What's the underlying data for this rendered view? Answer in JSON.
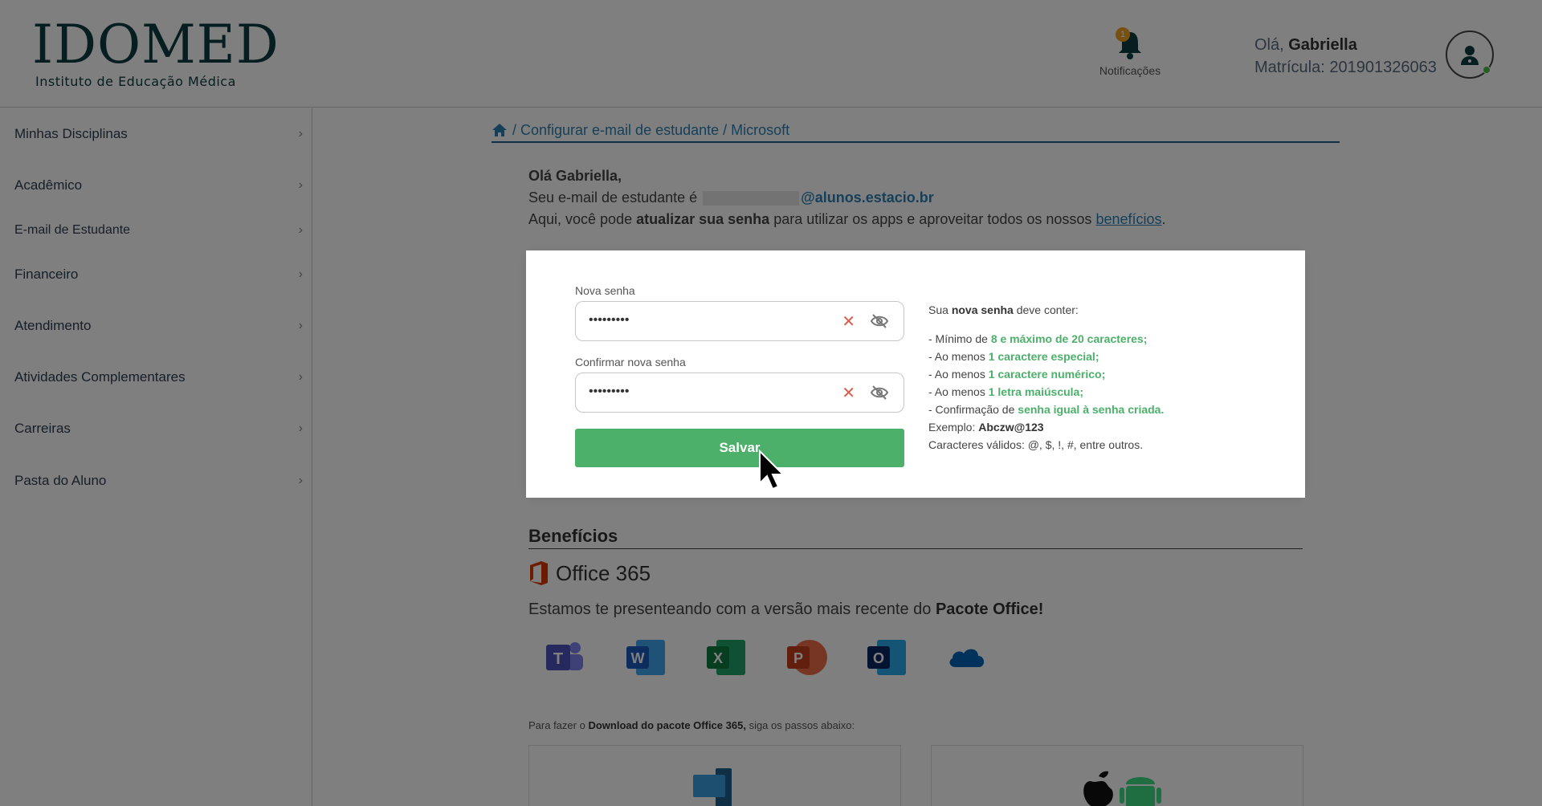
{
  "header": {
    "logo_main": "IDOMED",
    "logo_sub": "Instituto de Educação Médica",
    "notifications_badge": "1",
    "notifications_label": "Notificações",
    "greeting_prefix": "Olá,",
    "user_name": "Gabriella",
    "matricula": "Matrícula: 201901326063"
  },
  "sidebar": {
    "items": [
      {
        "label": "Minhas Disciplinas"
      },
      {
        "label": "Acadêmico"
      },
      {
        "label": "E-mail de Estudante"
      },
      {
        "label": "Financeiro"
      },
      {
        "label": "Atendimento"
      },
      {
        "label": "Atividades Complementares"
      },
      {
        "label": "Carreiras"
      },
      {
        "label": "Pasta do Aluno"
      }
    ]
  },
  "breadcrumb": {
    "path": "/ Configurar e-mail de estudante / Microsoft"
  },
  "intro": {
    "hello": "Olá Gabriella,",
    "email_prefix": "Seu e-mail de estudante é",
    "email_domain": "@alunos.estacio.br",
    "line3_a": "Aqui, você pode",
    "line3_bold": "atualizar sua senha",
    "line3_b": "para utilizar os apps e aproveitar todos os nossos",
    "line3_link": "benefícios",
    "line3_end": "."
  },
  "form": {
    "new_password_label": "Nova senha",
    "new_password_value": "•••••••••",
    "confirm_password_label": "Confirmar nova senha",
    "confirm_password_value": "•••••••••",
    "save_label": "Salvar"
  },
  "rules": {
    "intro_a": "Sua",
    "intro_bold": "nova senha",
    "intro_b": "deve conter:",
    "r1_a": "- Mínimo de",
    "r1_g": "8 e máximo de 20 caracteres;",
    "r2_a": "- Ao menos",
    "r2_g": "1 caractere especial;",
    "r3_a": "- Ao menos",
    "r3_g": "1 caractere numérico;",
    "r4_a": "- Ao menos",
    "r4_g": "1 letra maiúscula;",
    "r5_a": "- Confirmação de",
    "r5_g": "senha igual à senha criada.",
    "example_a": "Exemplo:",
    "example_b": "Abczw@123",
    "valid": "Caracteres válidos: @, $, !, #, entre outros."
  },
  "benefits": {
    "title": "Benefícios",
    "office_name": "Office 365",
    "presente_a": "Estamos te presenteando com a versão mais recente do",
    "presente_b": "Pacote Office!",
    "apps": [
      "teams-icon",
      "word-icon",
      "excel-icon",
      "powerpoint-icon",
      "outlook-icon",
      "onedrive-icon"
    ],
    "steps_a": "Para fazer o",
    "steps_b": "Download do pacote Office 365,",
    "steps_c": "siga os passos abaixo:"
  },
  "colors": {
    "brand": "#0d3c40",
    "link": "#2c80b4",
    "green": "#4cb06a",
    "error": "#e05a4a"
  }
}
